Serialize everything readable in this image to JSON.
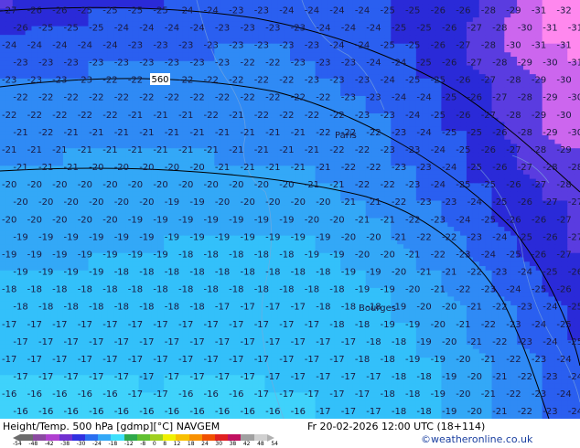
{
  "map": {
    "contour_label": "560",
    "city_labels": [
      "Paris",
      "Bourges"
    ],
    "grid_values": [
      [
        -27,
        -26,
        -26,
        -25,
        -25,
        -25,
        -25,
        -24,
        -24,
        -23,
        -23,
        -24,
        -24,
        -24,
        -24,
        -25,
        -25,
        -26,
        -26,
        -28,
        -29,
        -31,
        -32
      ],
      [
        -26,
        -25,
        -25,
        -25,
        -24,
        -24,
        -24,
        -24,
        -23,
        -23,
        -23,
        -23,
        -24,
        -24,
        -24,
        -25,
        -25,
        -26,
        -27,
        -28,
        -30,
        -31,
        -31
      ],
      [
        -24,
        -24,
        -24,
        -24,
        -24,
        -23,
        -23,
        -23,
        -23,
        -23,
        -23,
        -23,
        -23,
        -24,
        -24,
        -25,
        -25,
        -26,
        -27,
        -28,
        -30,
        -31,
        -31
      ],
      [
        -23,
        -23,
        -23,
        -23,
        -23,
        -23,
        -23,
        -23,
        -23,
        -22,
        -22,
        -23,
        -23,
        -23,
        -24,
        -24,
        -25,
        -26,
        -27,
        -28,
        -29,
        -30,
        -31
      ],
      [
        -23,
        -23,
        -23,
        -23,
        -22,
        -22,
        -22,
        -22,
        -22,
        -22,
        -22,
        -22,
        -23,
        -23,
        -23,
        -24,
        -25,
        -25,
        -26,
        -27,
        -28,
        -29,
        -30
      ],
      [
        -22,
        -22,
        -22,
        -22,
        -22,
        -22,
        -22,
        -22,
        -22,
        -22,
        -22,
        -22,
        -22,
        -23,
        -23,
        -24,
        -24,
        -25,
        -26,
        -27,
        -28,
        -29,
        -30
      ],
      [
        -22,
        -22,
        -22,
        -22,
        -22,
        -21,
        -21,
        -21,
        -22,
        -21,
        -22,
        -22,
        -22,
        -22,
        -23,
        -23,
        -24,
        -25,
        -26,
        -27,
        -28,
        -29,
        -30
      ],
      [
        -21,
        -22,
        -21,
        -21,
        -21,
        -21,
        -21,
        -21,
        -21,
        -21,
        -21,
        -21,
        -22,
        -22,
        -22,
        -23,
        -24,
        -25,
        -25,
        -26,
        -28,
        -29,
        -30
      ],
      [
        -21,
        -21,
        -21,
        -21,
        -21,
        -21,
        -21,
        -21,
        -21,
        -21,
        -21,
        -21,
        -21,
        -22,
        -22,
        -23,
        -23,
        -24,
        -25,
        -26,
        -27,
        -28,
        -29
      ],
      [
        -21,
        -21,
        -21,
        -20,
        -20,
        -20,
        -20,
        -20,
        -21,
        -21,
        -21,
        -21,
        -21,
        -22,
        -22,
        -23,
        -23,
        -24,
        -25,
        -26,
        -27,
        -28,
        -28
      ],
      [
        -20,
        -20,
        -20,
        -20,
        -20,
        -20,
        -20,
        -20,
        -20,
        -20,
        -20,
        -20,
        -21,
        -21,
        -22,
        -22,
        -23,
        -24,
        -25,
        -25,
        -26,
        -27,
        -28
      ],
      [
        -20,
        -20,
        -20,
        -20,
        -20,
        -20,
        -19,
        -19,
        -20,
        -20,
        -20,
        -20,
        -20,
        -21,
        -21,
        -22,
        -23,
        -23,
        -24,
        -25,
        -26,
        -27,
        -27
      ],
      [
        -20,
        -20,
        -20,
        -20,
        -20,
        -19,
        -19,
        -19,
        -19,
        -19,
        -19,
        -19,
        -20,
        -20,
        -21,
        -21,
        -22,
        -23,
        -24,
        -25,
        -26,
        -26,
        -27
      ],
      [
        -19,
        -19,
        -19,
        -19,
        -19,
        -19,
        -19,
        -19,
        -19,
        -19,
        -19,
        -19,
        -19,
        -20,
        -20,
        -21,
        -22,
        -22,
        -23,
        -24,
        -25,
        -26,
        -27
      ],
      [
        -19,
        -19,
        -19,
        -19,
        -19,
        -19,
        -19,
        -18,
        -18,
        -18,
        -18,
        -18,
        -19,
        -19,
        -20,
        -20,
        -21,
        -22,
        -23,
        -24,
        -25,
        -26,
        -27
      ],
      [
        -19,
        -19,
        -19,
        -19,
        -18,
        -18,
        -18,
        -18,
        -18,
        -18,
        -18,
        -18,
        -18,
        -19,
        -19,
        -20,
        -21,
        -21,
        -22,
        -23,
        -24,
        -25,
        -26
      ],
      [
        -18,
        -18,
        -18,
        -18,
        -18,
        -18,
        -18,
        -18,
        -18,
        -18,
        -18,
        -18,
        -18,
        -18,
        -19,
        -19,
        -20,
        -21,
        -22,
        -23,
        -24,
        -25,
        -26
      ],
      [
        -18,
        -18,
        -18,
        -18,
        -18,
        -18,
        -18,
        -18,
        -17,
        -17,
        -17,
        -17,
        -18,
        -18,
        -18,
        -19,
        -20,
        -20,
        -21,
        -22,
        -23,
        -24,
        -25
      ],
      [
        -17,
        -17,
        -17,
        -17,
        -17,
        -17,
        -17,
        -17,
        -17,
        -17,
        -17,
        -17,
        -17,
        -18,
        -18,
        -19,
        -19,
        -20,
        -21,
        -22,
        -23,
        -24,
        -25
      ],
      [
        -17,
        -17,
        -17,
        -17,
        -17,
        -17,
        -17,
        -17,
        -17,
        -17,
        -17,
        -17,
        -17,
        -17,
        -18,
        -18,
        -19,
        -20,
        -21,
        -22,
        -23,
        -24,
        -25
      ],
      [
        -17,
        -17,
        -17,
        -17,
        -17,
        -17,
        -17,
        -17,
        -17,
        -17,
        -17,
        -17,
        -17,
        -17,
        -18,
        -18,
        -19,
        -19,
        -20,
        -21,
        -22,
        -23,
        -24
      ],
      [
        -17,
        -17,
        -17,
        -17,
        -17,
        -17,
        -17,
        -17,
        -17,
        -17,
        -17,
        -17,
        -17,
        -17,
        -17,
        -18,
        -18,
        -19,
        -20,
        -21,
        -22,
        -23,
        -24
      ],
      [
        -16,
        -16,
        -16,
        -16,
        -16,
        -17,
        -17,
        -16,
        -16,
        -16,
        -17,
        -17,
        -17,
        -17,
        -17,
        -18,
        -18,
        -19,
        -20,
        -21,
        -22,
        -23,
        -24
      ],
      [
        -16,
        -16,
        -16,
        -16,
        -16,
        -16,
        -16,
        -16,
        -16,
        -16,
        -16,
        -16,
        -17,
        -17,
        -17,
        -18,
        -18,
        -19,
        -20,
        -21,
        -22,
        -23,
        -24
      ]
    ],
    "colors": {
      "c_-32": "#ff88ee",
      "c_-30": "#cc66ee",
      "c_-28": "#5a3ce0",
      "c_-26": "#2a2ad8",
      "c_-24": "#2a5ff0",
      "c_-22": "#2f8af5",
      "c_-20": "#33a8f7",
      "c_-18": "#33c0fa",
      "c_-16": "#3fd2fb"
    }
  },
  "footer": {
    "title": "Height/Temp. 500 hPa [gdmp][°C] NAVGEM",
    "datetime": "Fr 20-02-2026 12:00 UTC (18+114)",
    "credit": "©weatheronline.co.uk",
    "scale_ticks": [
      "-54",
      "-48",
      "-42",
      "-38",
      "-30",
      "-24",
      "-18",
      "-12",
      "-8",
      "0",
      "8",
      "12",
      "18",
      "24",
      "30",
      "38",
      "42",
      "48",
      "54"
    ],
    "scale_colors": [
      "#6b6b6b",
      "#8a4aa0",
      "#b040d0",
      "#7030d0",
      "#3030e0",
      "#2a6ef0",
      "#33a8f7",
      "#3fe0fb",
      "#2ea84a",
      "#60c030",
      "#a0d020",
      "#f0f000",
      "#f8c000",
      "#f89000",
      "#f05000",
      "#e02020",
      "#c01060",
      "#a0a0a0",
      "#d0d0d0"
    ]
  }
}
